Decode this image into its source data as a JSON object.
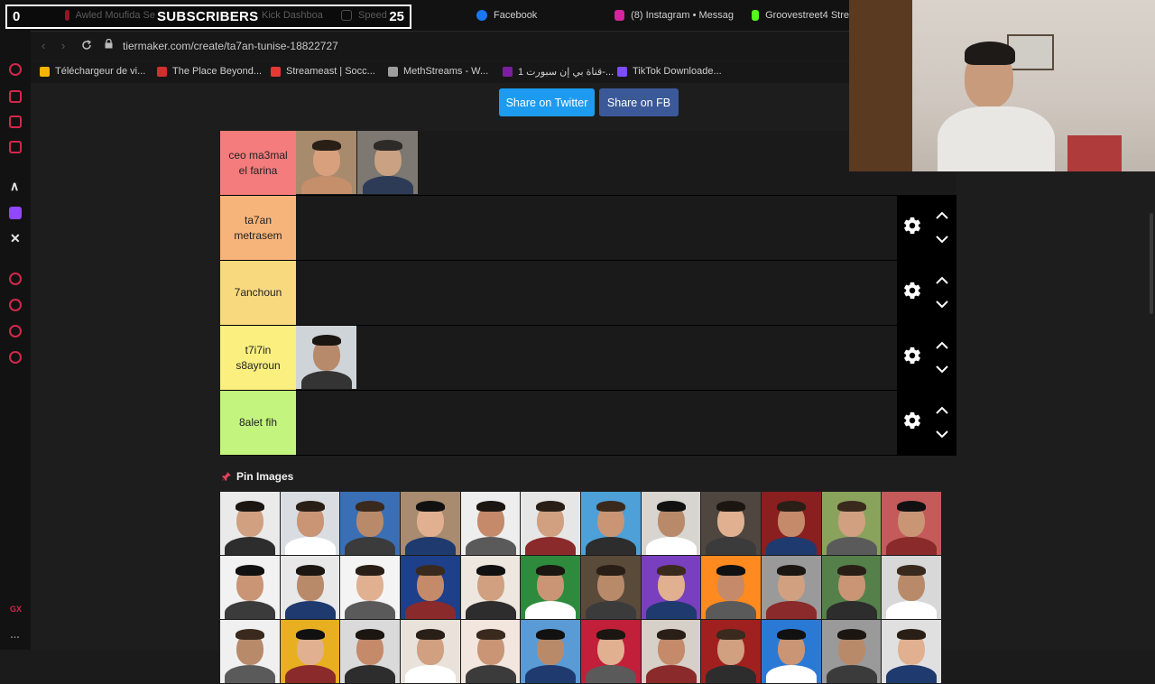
{
  "overlay": {
    "subs_left": "0",
    "subs_title": "SUBSCRIBERS",
    "subs_right": "25"
  },
  "tabs": [
    {
      "label": "Awled Moufida Se",
      "color": "#e0223a"
    },
    {
      "label": "Kick Dashboa",
      "color": "#53fc18"
    },
    {
      "label": "Speed",
      "color": "#888888"
    },
    {
      "label": "Facebook",
      "color": "#1877f2"
    },
    {
      "label": "(8) Instagram • Messag",
      "color": "#d6249f"
    },
    {
      "label": "Groovestreet4 Stre",
      "color": "#53fc18"
    }
  ],
  "address": {
    "url": "tiermaker.com/create/ta7an-tunise-18822727"
  },
  "bookmarks": [
    {
      "label": "Téléchargeur de vi...",
      "color": "#f5b400"
    },
    {
      "label": "The Place Beyond...",
      "color": "#d32f2f"
    },
    {
      "label": "Streameast | Socc...",
      "color": "#e53935"
    },
    {
      "label": "MethStreams - W...",
      "color": "#9e9e9e"
    },
    {
      "label": "قناة بي إن سبورت 1-...",
      "color": "#7b1fa2"
    },
    {
      "label": "TikTok Downloade...",
      "color": "#7c4dff"
    }
  ],
  "share": {
    "twitter": "Share on Twitter",
    "fb": "Share on FB"
  },
  "tiers": [
    {
      "label": "ceo ma3mal el farina",
      "color": "#f47c7c",
      "items": 2
    },
    {
      "label": "ta7an metrasem",
      "color": "#f7b47a",
      "items": 0
    },
    {
      "label": "7anchoun",
      "color": "#f9d97e",
      "items": 0
    },
    {
      "label": "t7i7in s8ayroun",
      "color": "#fbf07f",
      "items": 1
    },
    {
      "label": "8alet fih",
      "color": "#c3f57e",
      "items": 0
    }
  ],
  "pin_images": {
    "label": "Pin Images"
  },
  "colors": {
    "accent": "#d2284c",
    "twitter": "#1d9bf0",
    "facebook": "#3b5998"
  },
  "icons": [
    "gear-icon",
    "chevron-up-icon",
    "chevron-down-icon",
    "pin-icon",
    "lock-icon",
    "reload-icon"
  ]
}
